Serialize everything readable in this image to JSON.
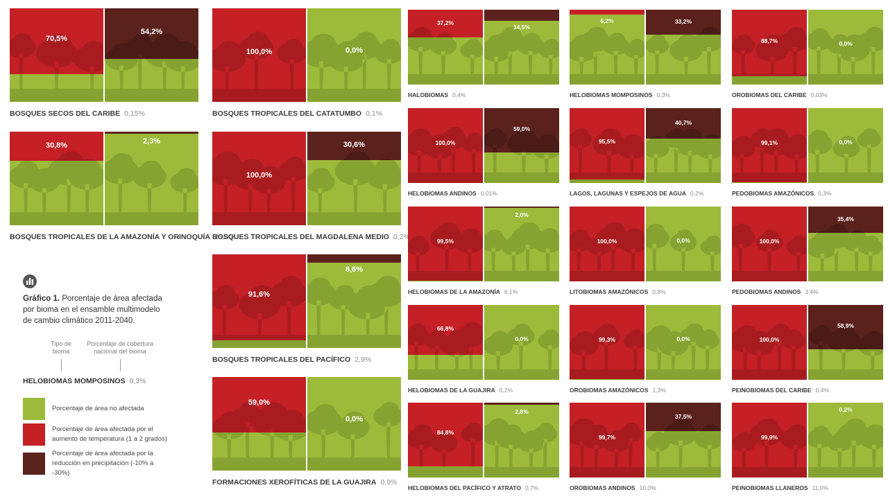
{
  "colors": {
    "green": "#9dba3b",
    "green_dark": "#86a331",
    "red": "#c42026",
    "red_dark": "#a81c20",
    "brown": "#5b221d",
    "brown_dark": "#4a1b17"
  },
  "chart_data": {
    "type": "bar",
    "title": "Gráfico 1. Porcentaje de área afectada por bioma en el ensamble multimodelo de cambio climático 2011-2040.",
    "series": [
      {
        "name": "Porcentaje de área afectada por el aumento de temperatura (1 a 2 grados)",
        "color": "#c42026"
      },
      {
        "name": "Porcentaje de área afectada por la reducción en precipitación (-10% a -30%)",
        "color": "#5b221d"
      }
    ],
    "biomes": [
      {
        "name": "BOSQUES SECOS DEL CARIBE",
        "coverage": "0,15%",
        "temp": 70.5,
        "temp_label": "70,5%",
        "precip": 54.2,
        "precip_label": "54,2%"
      },
      {
        "name": "BOSQUES TROPICALES DE LA AMAZONÍA Y ORINOQUÍA",
        "coverage": "25,0%",
        "temp": 30.8,
        "temp_label": "30,8%",
        "precip": 2.3,
        "precip_label": "2,3%"
      },
      {
        "name": "BOSQUES TROPICALES DEL CATATUMBO",
        "coverage": "0,1%",
        "temp": 100.0,
        "temp_label": "100,0%",
        "precip": 0.0,
        "precip_label": "0,0%"
      },
      {
        "name": "BOSQUES TROPICALES DEL MAGDALENA MEDIO",
        "coverage": "0,2%",
        "temp": 100.0,
        "temp_label": "100,0%",
        "precip": 30.6,
        "precip_label": "30,6%"
      },
      {
        "name": "BOSQUES TROPICALES DEL PACÍFICO",
        "coverage": "2,9%",
        "temp": 91.6,
        "temp_label": "91,6%",
        "precip": 8.6,
        "precip_label": "8,6%"
      },
      {
        "name": "FORMACIONES XEROFÍTICAS DE LA GUAJIRA",
        "coverage": "0,9%",
        "temp": 59.0,
        "temp_label": "59,0%",
        "precip": 0.0,
        "precip_label": "0,0%"
      },
      {
        "name": "HALOBIOMAS",
        "coverage": "0,4%",
        "temp": 37.2,
        "temp_label": "37,2%",
        "precip": 14.5,
        "precip_label": "14,5%"
      },
      {
        "name": "HELOBIOMAS ANDINOS",
        "coverage": "0,01%",
        "temp": 100.0,
        "temp_label": "100,0%",
        "precip": 59.0,
        "precip_label": "59,0%"
      },
      {
        "name": "HELOBIOMAS DE LA AMAZONÍA",
        "coverage": "6,1%",
        "temp": 99.5,
        "temp_label": "99,5%",
        "precip": 2.0,
        "precip_label": "2,0%"
      },
      {
        "name": "HELOBIOMAS DE LA GUAJIRA",
        "coverage": "0,2%",
        "temp": 66.8,
        "temp_label": "66,8%",
        "precip": 0.0,
        "precip_label": "0,0%"
      },
      {
        "name": "HELOBIOMAS DEL PACÍFICO Y ATRATO",
        "coverage": "0,7%",
        "temp": 84.8,
        "temp_label": "84,8%",
        "precip": 2.8,
        "precip_label": "2,8%"
      },
      {
        "name": "HELOBIOMAS MOMPOSINOS",
        "coverage": "0,3%",
        "temp": 6.2,
        "temp_label": "6,2%",
        "precip": 33.2,
        "precip_label": "33,2%"
      },
      {
        "name": "LAGOS, LAGUNAS Y ESPEJOS DE AGUA",
        "coverage": "0,2%",
        "temp": 95.5,
        "temp_label": "95,5%",
        "precip": 40.7,
        "precip_label": "40,7%"
      },
      {
        "name": "LITOBIOMAS AMAZÓNICOS",
        "coverage": "0,8%",
        "temp": 100.0,
        "temp_label": "100,0%",
        "precip": 0.0,
        "precip_label": "0,0%"
      },
      {
        "name": "OROBIOMAS AMAZÓNICOS",
        "coverage": "1,3%",
        "temp": 99.3,
        "temp_label": "99,3%",
        "precip": 0.0,
        "precip_label": "0,0%"
      },
      {
        "name": "OROBIOMAS ANDINOS",
        "coverage": "10,0%",
        "temp": 99.7,
        "temp_label": "99,7%",
        "precip": 37.5,
        "precip_label": "37,5%"
      },
      {
        "name": "OROBIOMAS DEL CARIBE",
        "coverage": "0,03%",
        "temp": 88.7,
        "temp_label": "88,7%",
        "precip": 0.0,
        "precip_label": "0,0%"
      },
      {
        "name": "PEDOBIOMAS AMAZÓNICOS",
        "coverage": "0,3%",
        "temp": 99.1,
        "temp_label": "99,1%",
        "precip": 0.0,
        "precip_label": "0,0%"
      },
      {
        "name": "PEDOBIOMAS ANDINOS",
        "coverage": "3,4%",
        "temp": 100.0,
        "temp_label": "100,0%",
        "precip": 35.4,
        "precip_label": "35,4%"
      },
      {
        "name": "PEINOBIOMAS DEL CARIBE",
        "coverage": "0,4%",
        "temp": 100.0,
        "temp_label": "100,0%",
        "precip": 58.9,
        "precip_label": "58,9%"
      },
      {
        "name": "PEINOBIOMAS LLANEROS",
        "coverage": "11,0%",
        "temp": 99.9,
        "temp_label": "99,9%",
        "precip": 0.2,
        "precip_label": "0,2%"
      }
    ]
  },
  "legend": {
    "icon": "bar-chart-icon",
    "title_bold": "Gráfico 1.",
    "title_rest": " Porcentaje de área afectada por bioma en el ensamble multimodelo de cambio climático 2011-2040.",
    "annotation_type": "Tipo de bioma",
    "annotation_coverage": "Porcentaje de cobertura nacional del bioma",
    "example_name": "HELOBIOMAS MOMPOSINOS",
    "example_coverage": "0,3%",
    "items": [
      {
        "label": "Porcentaje de área no afectada",
        "color": "#9dba3b"
      },
      {
        "label": "Porcentaje de área afectada por el aumento de temperatura (1 a 2 grados)",
        "color": "#c42026"
      },
      {
        "label": "Porcentaje de área afectada por la reducción en precipitación (-10% a -30%)",
        "color": "#5b221d"
      }
    ]
  }
}
